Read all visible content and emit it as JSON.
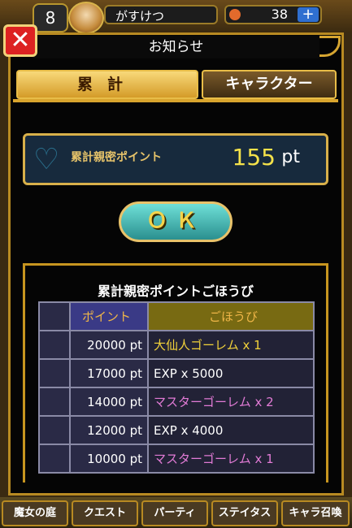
{
  "header": {
    "level": "8",
    "player_name": "がすけつ",
    "gem_count": "38",
    "plus_label": "+"
  },
  "dialog": {
    "title": "お知らせ",
    "close_label": "✕",
    "tabs": [
      {
        "label": "累計",
        "active": true
      },
      {
        "label": "キャラクター",
        "active": false
      }
    ],
    "points_label": "累計親密ポイント",
    "points_value": "155",
    "points_unit": "pt",
    "ok_label": "ＯＫ"
  },
  "rewards": {
    "title": "累計親密ポイントごほうび",
    "columns": [
      "",
      "ポイント",
      "ごほうび"
    ],
    "rows": [
      {
        "points": "20000 pt",
        "reward": "大仙人ゴーレム x 1",
        "color": "#f2d23a"
      },
      {
        "points": "17000 pt",
        "reward": "EXP x 5000",
        "color": "#ffffff"
      },
      {
        "points": "14000 pt",
        "reward": "マスターゴーレム x 2",
        "color": "#e27bd6"
      },
      {
        "points": "12000 pt",
        "reward": "EXP x 4000",
        "color": "#ffffff"
      },
      {
        "points": "10000 pt",
        "reward": "マスターゴーレム x 1",
        "color": "#e27bd6"
      }
    ]
  },
  "footer": {
    "nav": [
      "魔女の庭",
      "クエスト",
      "パーティ",
      "ステイタス",
      "キャラ召喚"
    ]
  }
}
